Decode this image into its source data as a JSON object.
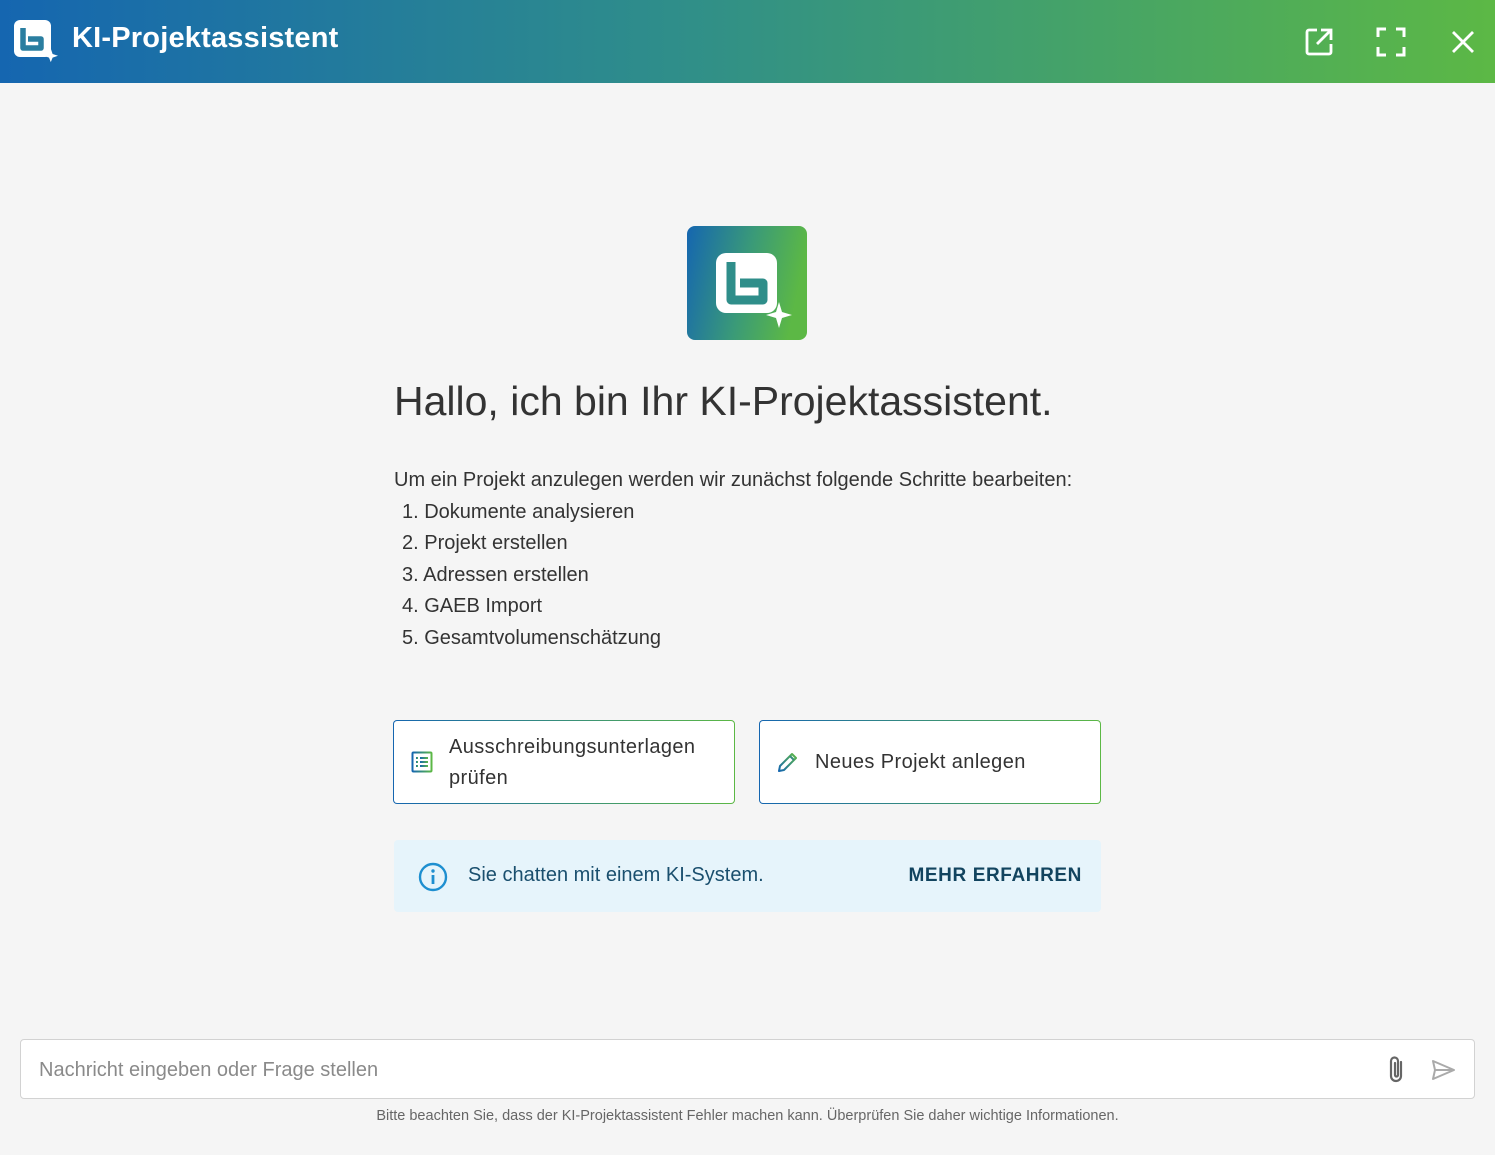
{
  "window": {
    "title": "KI-Projektassistent",
    "icons": {
      "logo": "assistant-logo-icon",
      "popout": "open-in-new-icon",
      "fullscreen": "fullscreen-icon",
      "close": "close-icon"
    }
  },
  "welcome": {
    "greeting": "Hallo, ich bin Ihr KI-Projektassistent.",
    "intro": "Um ein Projekt anzulegen werden wir zunächst folgende Schritte bearbeiten:",
    "steps": [
      "1. Dokumente analysieren",
      "2. Projekt erstellen",
      "3. Adressen erstellen",
      "4. GAEB Import",
      "5. Gesamtvolumenschätzung"
    ]
  },
  "actions": [
    {
      "label": "Ausschreibungsunterlagen prüfen",
      "icon": "document-list-icon"
    },
    {
      "label": "Neues Projekt anlegen",
      "icon": "pencil-icon"
    }
  ],
  "info": {
    "text": "Sie chatten mit einem KI-System.",
    "link": "MEHR ERFAHREN",
    "icon": "info-icon"
  },
  "composer": {
    "placeholder": "Nachricht eingeben oder Frage stellen",
    "value": "",
    "attach_icon": "paperclip-icon",
    "send_icon": "send-icon"
  },
  "disclaimer": "Bitte beachten Sie, dass der KI-Projektassistent Fehler machen kann. Überprüfen Sie daher wichtige Informationen.",
  "colors": {
    "gradient_start": "#1566b0",
    "gradient_end": "#5cb845",
    "info_bg": "#e6f4fb",
    "info_accent": "#1e8fd0"
  }
}
